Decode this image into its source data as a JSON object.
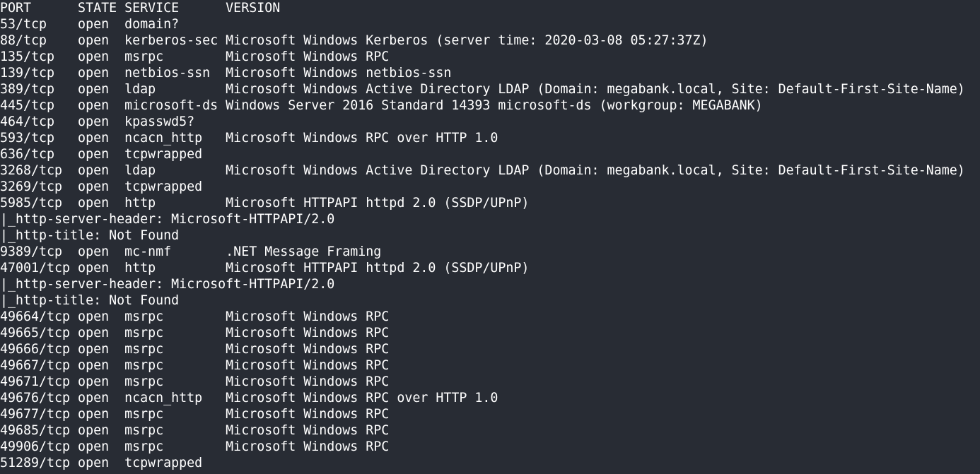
{
  "terminal": {
    "background": "#282c34",
    "foreground": "#ffffff",
    "lines": [
      "PORT      STATE SERVICE      VERSION",
      "53/tcp    open  domain?",
      "88/tcp    open  kerberos-sec Microsoft Windows Kerberos (server time: 2020-03-08 05:27:37Z)",
      "135/tcp   open  msrpc        Microsoft Windows RPC",
      "139/tcp   open  netbios-ssn  Microsoft Windows netbios-ssn",
      "389/tcp   open  ldap         Microsoft Windows Active Directory LDAP (Domain: megabank.local, Site: Default-First-Site-Name)",
      "445/tcp   open  microsoft-ds Windows Server 2016 Standard 14393 microsoft-ds (workgroup: MEGABANK)",
      "464/tcp   open  kpasswd5?",
      "593/tcp   open  ncacn_http   Microsoft Windows RPC over HTTP 1.0",
      "636/tcp   open  tcpwrapped",
      "3268/tcp  open  ldap         Microsoft Windows Active Directory LDAP (Domain: megabank.local, Site: Default-First-Site-Name)",
      "3269/tcp  open  tcpwrapped",
      "5985/tcp  open  http         Microsoft HTTPAPI httpd 2.0 (SSDP/UPnP)",
      "|_http-server-header: Microsoft-HTTPAPI/2.0",
      "|_http-title: Not Found",
      "9389/tcp  open  mc-nmf       .NET Message Framing",
      "47001/tcp open  http         Microsoft HTTPAPI httpd 2.0 (SSDP/UPnP)",
      "|_http-server-header: Microsoft-HTTPAPI/2.0",
      "|_http-title: Not Found",
      "49664/tcp open  msrpc        Microsoft Windows RPC",
      "49665/tcp open  msrpc        Microsoft Windows RPC",
      "49666/tcp open  msrpc        Microsoft Windows RPC",
      "49667/tcp open  msrpc        Microsoft Windows RPC",
      "49671/tcp open  msrpc        Microsoft Windows RPC",
      "49676/tcp open  ncacn_http   Microsoft Windows RPC over HTTP 1.0",
      "49677/tcp open  msrpc        Microsoft Windows RPC",
      "49685/tcp open  msrpc        Microsoft Windows RPC",
      "49906/tcp open  msrpc        Microsoft Windows RPC",
      "51289/tcp open  tcpwrapped"
    ]
  }
}
